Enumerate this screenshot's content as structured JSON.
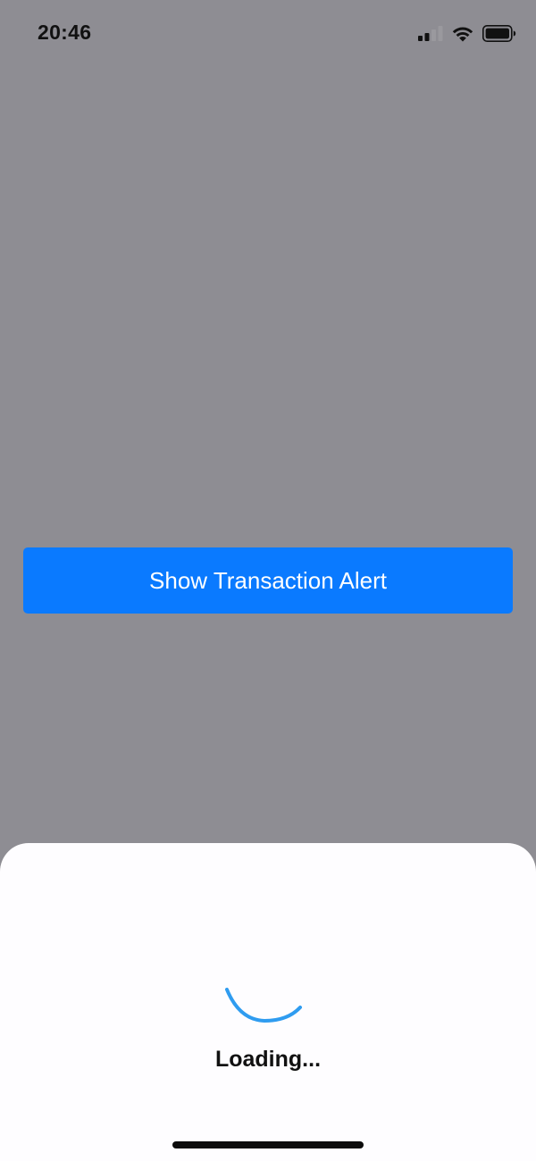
{
  "status_bar": {
    "time": "20:46",
    "icons": [
      "cellular-signal-icon",
      "wifi-icon",
      "battery-icon"
    ]
  },
  "main": {
    "button_label": "Show Transaction Alert"
  },
  "sheet": {
    "loading_text": "Loading...",
    "spinner_icon": "loading-spinner-icon"
  },
  "colors": {
    "overlay_background": "#8e8d93",
    "button_blue": "#0a7aff",
    "spinner_blue": "#2f9cf0",
    "sheet_background": "#fefdff",
    "text_dark": "#111111"
  }
}
